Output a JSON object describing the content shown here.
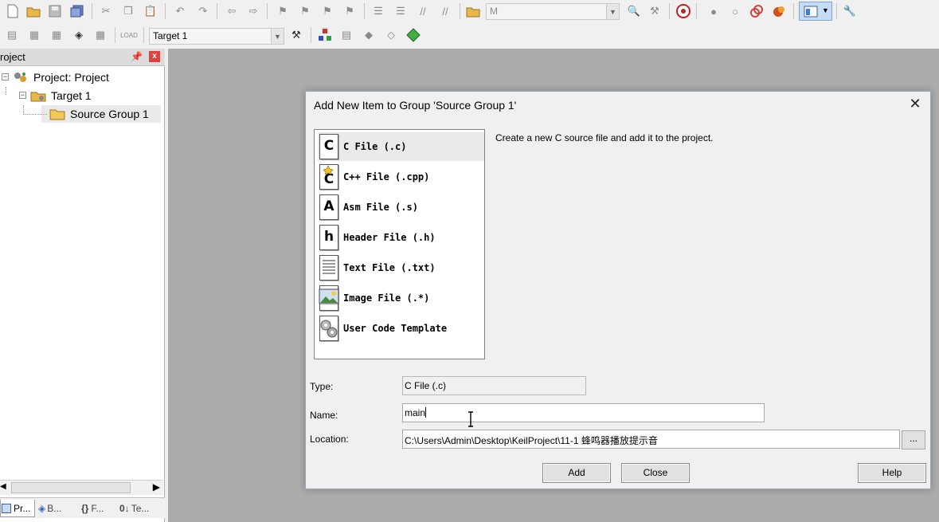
{
  "toolbar": {
    "target_select": "Target 1",
    "find_combo": "M"
  },
  "project_panel": {
    "title": "roject",
    "pin_icon": "pin-icon",
    "close_label": "x",
    "tree": {
      "project_label": "Project: Project",
      "target_label": "Target 1",
      "group_label": "Source Group 1"
    },
    "tabs": [
      {
        "label": "Pr..."
      },
      {
        "label": "B..."
      },
      {
        "label": "F..."
      },
      {
        "label": "Te..."
      }
    ]
  },
  "dialog": {
    "title": "Add New Item to Group 'Source Group 1'",
    "close_label": "✕",
    "items": [
      {
        "label": "C File (.c)",
        "glyph": "C"
      },
      {
        "label": "C++ File (.cpp)",
        "glyph": "C"
      },
      {
        "label": "Asm File (.s)",
        "glyph": "A"
      },
      {
        "label": "Header File (.h)",
        "glyph": "h"
      },
      {
        "label": "Text File (.txt)",
        "glyph": ""
      },
      {
        "label": "Image File (.*)",
        "glyph": ""
      },
      {
        "label": "User Code Template",
        "glyph": ""
      }
    ],
    "description": "Create a new C source file and add it to the project.",
    "type_label": "Type:",
    "type_value": "C File (.c)",
    "name_label": "Name:",
    "name_value": "main",
    "location_label": "Location:",
    "location_value": "C:\\Users\\Admin\\Desktop\\KeilProject\\11-1 蜂鸣器播放提示音",
    "browse_label": "...",
    "add_label": "Add",
    "close_button_label": "Close",
    "help_label": "Help"
  }
}
